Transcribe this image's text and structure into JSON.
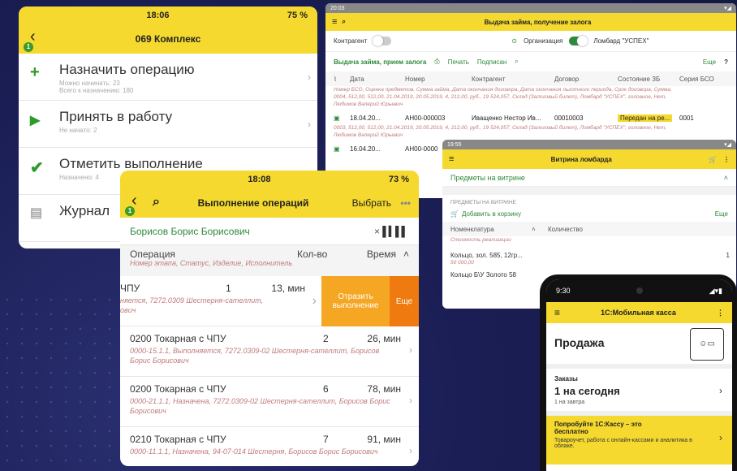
{
  "screenA": {
    "time": "18:06",
    "battery": "75 %",
    "badge": "1",
    "title": "069 Комплекс",
    "ops": [
      {
        "label": "Назначить операцию",
        "sub1": "Можно начинать: 23",
        "sub2": "Всего к назначению: 180"
      },
      {
        "label": "Принять в работу",
        "sub1": "Не начато: 2",
        "sub2": ""
      },
      {
        "label": "Отметить выполнение",
        "sub1": "Назначено: 4",
        "sub2": ""
      },
      {
        "label": "Журнал",
        "sub1": "",
        "sub2": ""
      }
    ]
  },
  "screenB": {
    "status_time": "20:03",
    "title": "Выдача займа, получение залога",
    "contragent_label": "Контрагент",
    "org_label": "Организация",
    "org_value": "Ломбард \"УСПЕХ\"",
    "link_main": "Выдача займа, прием залога",
    "print": "Печать",
    "sign": "Подписан",
    "more": "Еще",
    "help": "?",
    "cols": [
      "Дата",
      "Номер",
      "Контрагент",
      "Договор",
      "Состояние ЗБ",
      "Серия БСО"
    ],
    "hint": "Номер БСО, Оценка предметов, Сумма займа, Дата окончания договора, Дата окончания льготного периода, Срок договора, Сумма,",
    "rows": [
      {
        "extra": "0004, 512,00, 512,00, 21.04.2019, 20.05.2019, 4, 212,00, руб., 19 524,057, Склад (Залоговый билет), Ломбард \"УСПЕХ\", головное, Нет,",
        "who": "Любимов Валерий Юрьевич"
      },
      {
        "date": "18.04.20...",
        "num": "АН00-000003",
        "contr": "Иващенко Нестор Ив...",
        "dog": "00010003",
        "state": "Передан на ре...",
        "ser": "0001",
        "extra": "0003, 512,00, 512,00, 21.04.2019, 20.05.2019, 4, 212,00, руб., 19 524,057, Склад (Залоговый билет), Ломбард \"УСПЕХ\", головное, Нет,",
        "who": "Любимов Валерий Юрьевич"
      },
      {
        "date": "16.04.20...",
        "num": "АН00-0000"
      }
    ]
  },
  "screenC": {
    "time": "19:55",
    "title": "Витрина ломбарда",
    "section": "Предметы на витрине",
    "subhead": "ПРЕДМЕТЫ НА ВИТРИНЕ",
    "add": "Добавить в корзину",
    "more": "Еще",
    "col1": "Номенклатура",
    "col2": "Количество",
    "hint": "Стоимость реализации",
    "items": [
      {
        "name": "Кольцо, зол. 585, 12гр...",
        "price": "50 000,00",
        "qty": "1"
      },
      {
        "name": "Кольцо Б\\У Золото 58",
        "price": "",
        "qty": ""
      }
    ]
  },
  "screenD": {
    "time": "18:08",
    "battery": "73 %",
    "badge": "1",
    "title": "Выполнение операций",
    "select": "Выбрать",
    "search_value": "Борисов Борис Борисович",
    "col_op": "Операция",
    "col_qty": "Кол-во",
    "col_time": "Время",
    "hint": "Номер этапа, Статус, Изделие, Исполнитель",
    "swipe": {
      "name": "ЧПУ",
      "qty": "1",
      "time": "13, мин",
      "desc": "няется, 7272.0309 Шестерня-сателлит,",
      "desc2": "ович",
      "action": "Отразить выполнение",
      "more": "Еще"
    },
    "rows": [
      {
        "name": "0200 Токарная с ЧПУ",
        "qty": "2",
        "time": "26, мин",
        "desc": "0000-15.1.1, Выполняется, 7272.0309-02 Шестерня-сателлит, Борисов Борис Борисович"
      },
      {
        "name": "0200 Токарная с ЧПУ",
        "qty": "6",
        "time": "78, мин",
        "desc": "0000-21.1.1, Назначена, 7272.0309-02 Шестерня-сателлит, Борисов Борис Борисович"
      },
      {
        "name": "0210 Токарная с ЧПУ",
        "qty": "7",
        "time": "91, мин",
        "desc": "0000-11.1.1, Назначена, 94-07-014 Шестерня, Борисов Борис Борисович"
      }
    ]
  },
  "screenE": {
    "time": "9:30",
    "title": "1С:Мобильная касса",
    "sale": "Продажа",
    "orders_label": "Заказы",
    "orders_today": "1 на сегодня",
    "orders_tomorrow": "1 на завтра",
    "promo_title": "Попробуйте 1С:Кассу – это бесплатно",
    "promo_text": "Товароучет, работа с онлайн-кассами и аналитика в облаке."
  }
}
